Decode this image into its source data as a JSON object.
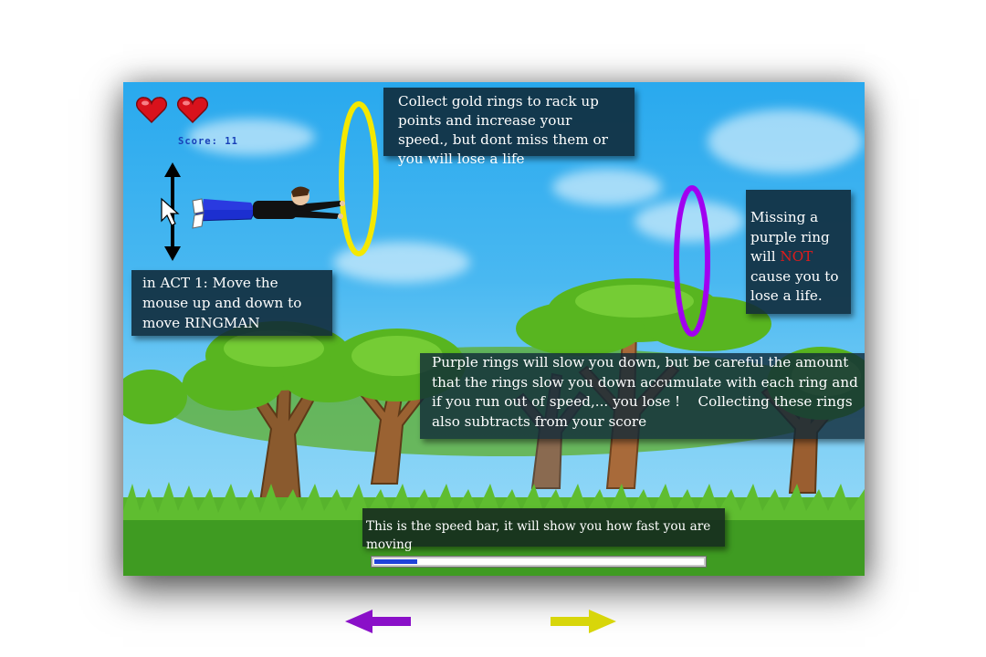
{
  "hud": {
    "lives": 2,
    "score_text": "Score: 11"
  },
  "tutorial": {
    "gold_rings": "Collect gold rings to rack up points and increase your speed., but dont miss them or you will lose a life",
    "act1_controls": "in ACT 1: Move the mouse up and down to move RINGMAN",
    "purple_miss": {
      "before": "Missing a purple ring will ",
      "emphasis": "NOT",
      "after": " cause you to lose a life."
    },
    "purple_rings": "Purple rings will slow you down, but be careful the amount that the rings slow you down accumulate with each ring and if you run out of speed,... you lose !    Collecting these rings also subtracts from your score",
    "speed_bar": "This is the speed bar, it will show you how fast you are moving"
  },
  "speed": {
    "level": 0.13
  },
  "colors": {
    "gold_ring": "#f4e800",
    "purple_ring": "#a100f0",
    "nav_left": "#8a10c8",
    "nav_right": "#d8d60a",
    "speed_fill": "#1f43d9",
    "score": "#1840b8"
  },
  "icons": {
    "lives": "heart-icon",
    "control_hint": "up-down-arrow-icon",
    "cursor": "mouse-cursor-icon",
    "nav_prev": "arrow-left-icon",
    "nav_next": "arrow-right-icon"
  }
}
